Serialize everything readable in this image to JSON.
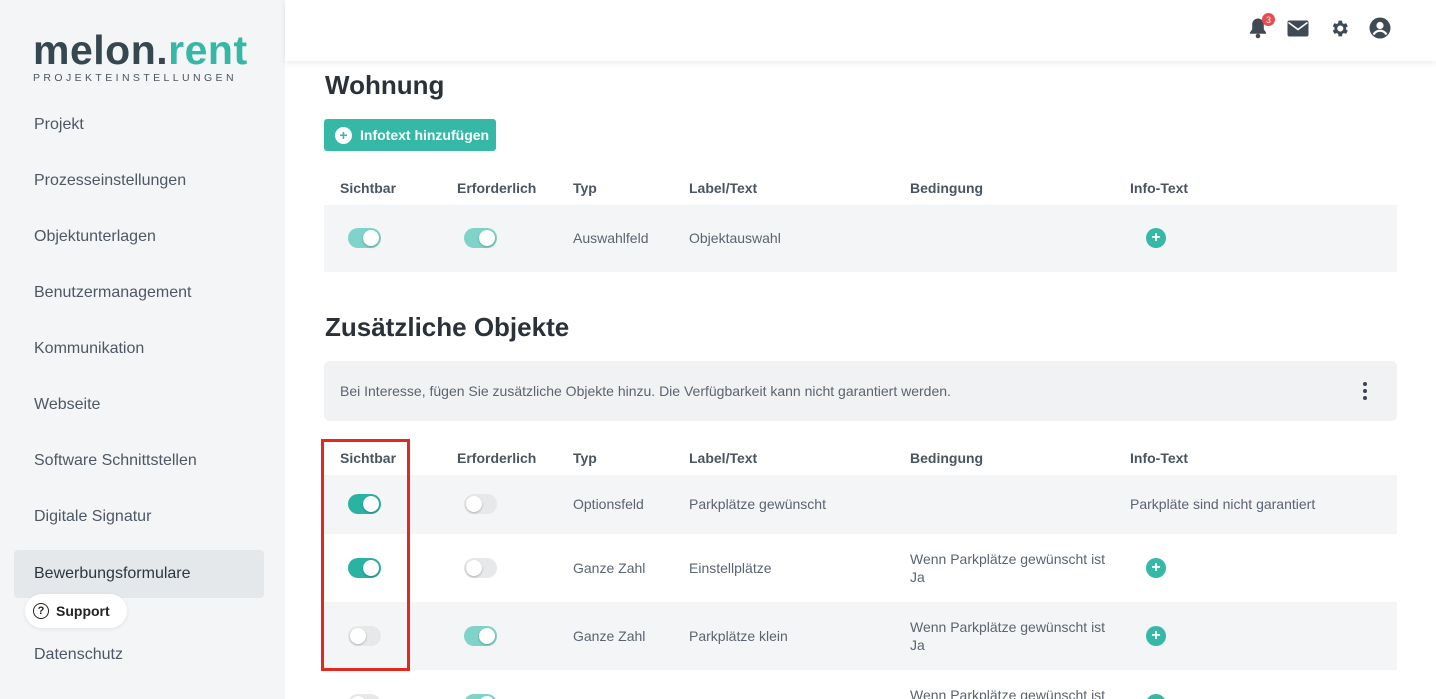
{
  "brand": {
    "name_main": "melon.",
    "name_accent": "rent",
    "subtitle": "PROJEKTEINSTELLUNGEN"
  },
  "sidebar": {
    "items": [
      {
        "label": "Projekt"
      },
      {
        "label": "Prozesseinstellungen"
      },
      {
        "label": "Objektunterlagen"
      },
      {
        "label": "Benutzermanagement"
      },
      {
        "label": "Kommunikation"
      },
      {
        "label": "Webseite"
      },
      {
        "label": "Software Schnittstellen"
      },
      {
        "label": "Digitale Signatur"
      },
      {
        "label": "Bewerbungsformulare",
        "active": true
      },
      {
        "label": "Datenschutz"
      }
    ],
    "support_label": "Support",
    "support_icon": "?"
  },
  "topbar": {
    "notification_count": "3",
    "icons": [
      "bell-icon",
      "mail-icon",
      "gear-icon",
      "user-icon"
    ]
  },
  "section_wohnung": {
    "title": "Wohnung",
    "add_button": "Infotext hinzufügen",
    "columns": [
      "Sichtbar",
      "Erforderlich",
      "Typ",
      "Label/Text",
      "Bedingung",
      "Info-Text"
    ],
    "rows": [
      {
        "sichtbar": "on-light",
        "erforderlich": "on-light",
        "typ": "Auswahlfeld",
        "label": "Objektauswahl",
        "bedingung": "",
        "info": ""
      }
    ]
  },
  "section_zusatz": {
    "title": "Zusätzliche Objekte",
    "info_text": "Bei Interesse, fügen Sie zusätzliche Objekte hinzu. Die Verfügbarkeit kann nicht garantiert werden.",
    "columns": [
      "Sichtbar",
      "Erforderlich",
      "Typ",
      "Label/Text",
      "Bedingung",
      "Info-Text"
    ],
    "rows": [
      {
        "sichtbar": "on",
        "erforderlich": "off",
        "typ": "Optionsfeld",
        "label": "Parkplätze gewünscht",
        "bedingung_1": "",
        "bedingung_2": "",
        "info": "Parkpläte sind nicht garantiert"
      },
      {
        "sichtbar": "on",
        "erforderlich": "off",
        "typ": "Ganze Zahl",
        "label": "Einstellplätze",
        "bedingung_1": "Wenn Parkplätze gewünscht ist",
        "bedingung_2": "Ja",
        "info": ""
      },
      {
        "sichtbar": "off",
        "erforderlich": "on-light",
        "typ": "Ganze Zahl",
        "label": "Parkplätze klein",
        "bedingung_1": "Wenn Parkplätze gewünscht ist",
        "bedingung_2": "Ja",
        "info": ""
      },
      {
        "sichtbar": "off",
        "erforderlich": "on-light",
        "typ": "",
        "label": "",
        "bedingung_1": "Wenn Parkplätze gewünscht ist",
        "bedingung_2": "",
        "info": ""
      }
    ]
  },
  "colors": {
    "accent": "#35b8a6",
    "toggle_on": "#2ab3a0",
    "toggle_on_light": "#7fd3c8",
    "highlight": "#e5281e",
    "badge": "#e84c4f"
  }
}
